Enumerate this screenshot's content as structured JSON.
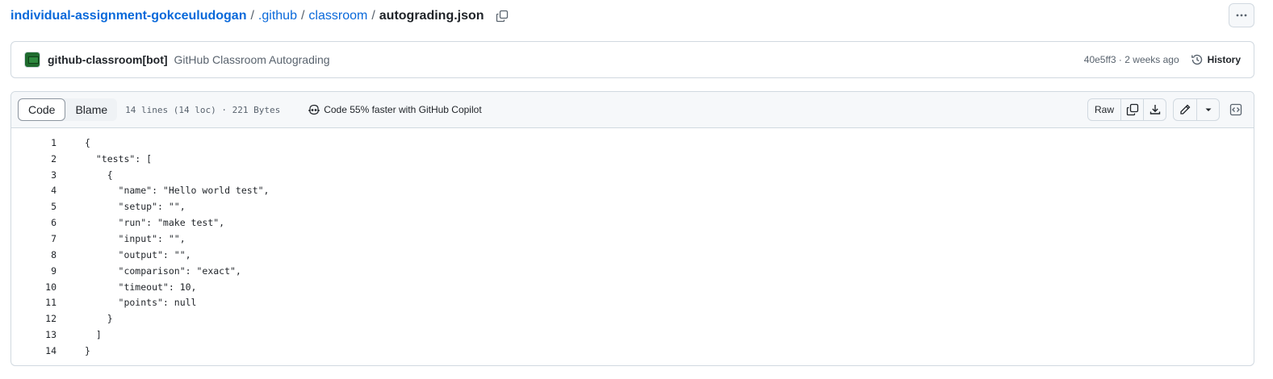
{
  "breadcrumb": {
    "repo": "individual-assignment-gokceuludogan",
    "parts": [
      ".github",
      "classroom"
    ],
    "separator": "/",
    "file": "autograding.json"
  },
  "commit": {
    "author": "github-classroom[bot]",
    "message": "GitHub Classroom Autograding",
    "meta": "40e5ff3 · 2 weeks ago",
    "history_label": "History"
  },
  "file_header": {
    "tabs": [
      "Code",
      "Blame"
    ],
    "active_tab": "Code",
    "meta": "14 lines (14 loc) · 221 Bytes",
    "copilot": "Code 55% faster with GitHub Copilot",
    "raw_label": "Raw"
  },
  "code_lines": [
    "{",
    "  \"tests\": [",
    "    {",
    "      \"name\": \"Hello world test\",",
    "      \"setup\": \"\",",
    "      \"run\": \"make test\",",
    "      \"input\": \"\",",
    "      \"output\": \"\",",
    "      \"comparison\": \"exact\",",
    "      \"timeout\": 10,",
    "      \"points\": null",
    "    }",
    "  ]",
    "}"
  ],
  "icons": [
    "copy-icon",
    "kebab-icon",
    "history-icon",
    "copilot-icon",
    "download-icon",
    "pencil-icon",
    "triangle-down-icon",
    "code-symbols-icon"
  ],
  "colors": {
    "link": "#0969da",
    "muted": "#59636e",
    "border": "#d1d9e0",
    "header_bg": "#f6f8fa"
  }
}
